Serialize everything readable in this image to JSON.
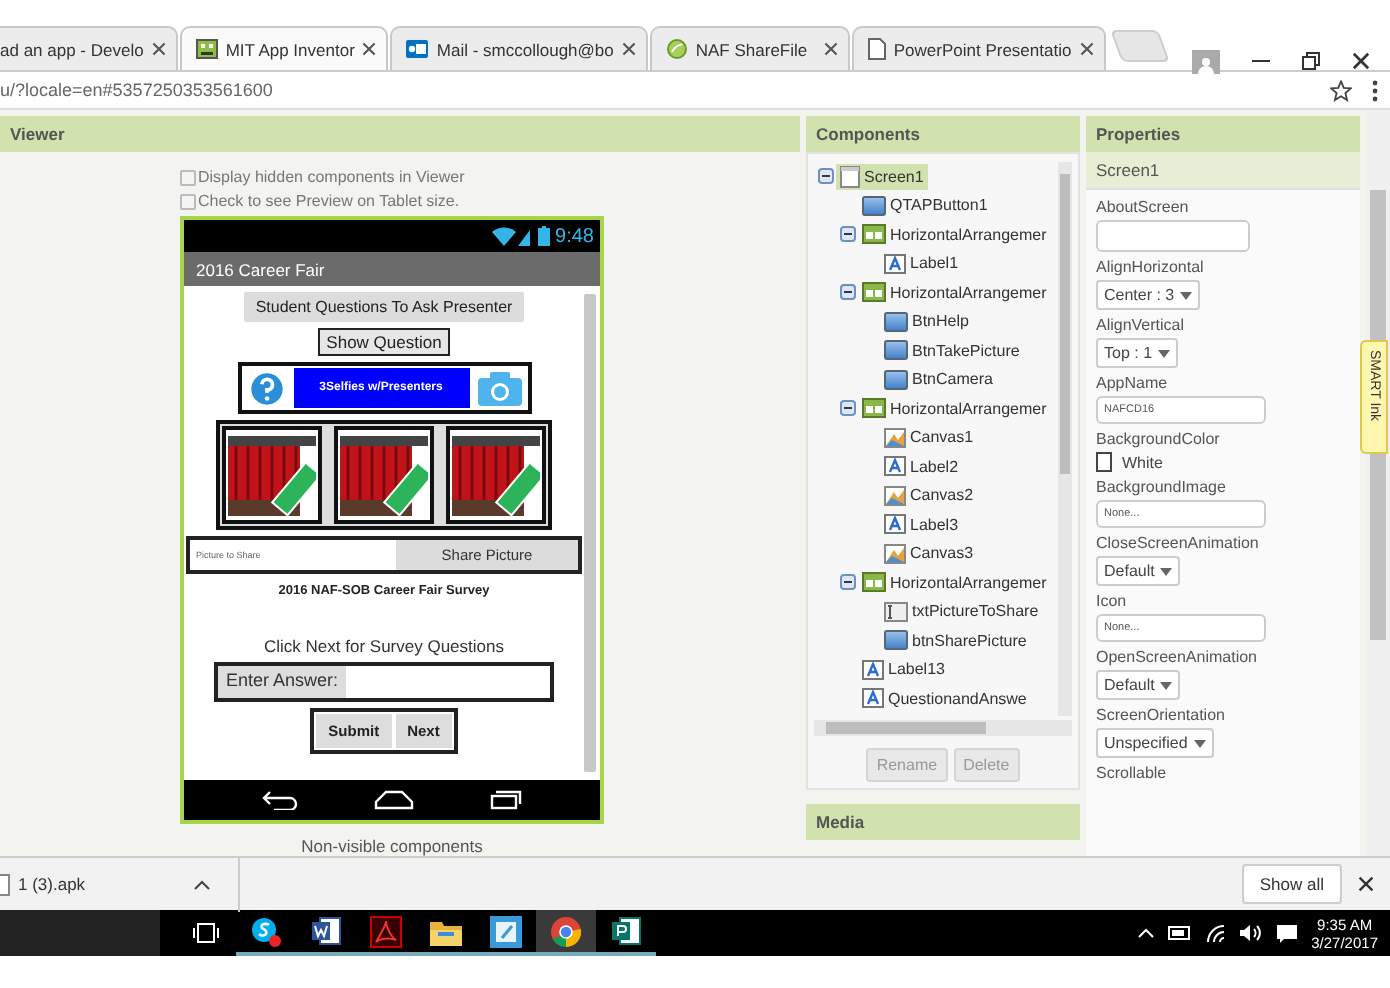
{
  "browser": {
    "tabs": [
      {
        "title": "ad an app - Develo",
        "kind": "none",
        "selected": false
      },
      {
        "title": "MIT App Inventor",
        "kind": "robot",
        "selected": true
      },
      {
        "title": "Mail - smccollough@bo",
        "kind": "mail",
        "selected": false
      },
      {
        "title": "NAF ShareFile",
        "kind": "leaf",
        "selected": false
      },
      {
        "title": "PowerPoint Presentatio",
        "kind": "page",
        "selected": false
      }
    ],
    "address": "u/?locale=en#5357250353561600"
  },
  "viewer": {
    "title": "Viewer",
    "options": [
      {
        "label": "Display hidden components in Viewer",
        "checked": false
      },
      {
        "label": "Check to see Preview on Tablet size.",
        "checked": false
      }
    ],
    "phone": {
      "time": "9:48",
      "title": "2016 Career Fair",
      "items": [
        {
          "kind": "button",
          "text": "Student Questions To Ask Presenter"
        },
        {
          "kind": "outlined_button",
          "text": "Show Question"
        },
        {
          "kind": "icon_row",
          "text": "3Selfies w/Presenters"
        },
        {
          "kind": "canvas_row",
          "canvases": [
            {
              "kind": "picture"
            },
            {
              "kind": "picture"
            },
            {
              "kind": "picture"
            }
          ]
        },
        {
          "kind": "share_row",
          "placeholder": "Picture to Share",
          "button": "Share Picture"
        },
        {
          "kind": "caption",
          "text": "2016 NAF-SOB Career Fair Survey"
        },
        {
          "kind": "label",
          "text": "Click Next for Survey Questions"
        },
        {
          "kind": "answer_row",
          "label": "Enter Answer:"
        },
        {
          "kind": "button_row",
          "buttons": [
            "Submit",
            "Next"
          ]
        }
      ]
    },
    "non_visible": "Non-visible components"
  },
  "components": {
    "title": "Components",
    "tree": [
      {
        "name": "Screen1",
        "kind": "screen",
        "selected": true,
        "expanded": true,
        "children": [
          {
            "name": "QTAPButton1",
            "kind": "button",
            "selected": false
          },
          {
            "name": "HorizontalArrangemer",
            "kind": "arrangement",
            "selected": false,
            "expanded": true,
            "children": [
              {
                "name": "Label1",
                "kind": "label",
                "selected": false
              }
            ]
          },
          {
            "name": "HorizontalArrangemer",
            "kind": "arrangement",
            "selected": false,
            "expanded": true,
            "children": [
              {
                "name": "BtnHelp",
                "kind": "button",
                "selected": false
              },
              {
                "name": "BtnTakePicture",
                "kind": "button",
                "selected": false
              },
              {
                "name": "BtnCamera",
                "kind": "button",
                "selected": false
              }
            ]
          },
          {
            "name": "HorizontalArrangemer",
            "kind": "arrangement",
            "selected": false,
            "expanded": true,
            "children": [
              {
                "name": "Canvas1",
                "kind": "canvas",
                "selected": false
              },
              {
                "name": "Label2",
                "kind": "label",
                "selected": false
              },
              {
                "name": "Canvas2",
                "kind": "canvas",
                "selected": false
              },
              {
                "name": "Label3",
                "kind": "label",
                "selected": false
              },
              {
                "name": "Canvas3",
                "kind": "canvas",
                "selected": false
              }
            ]
          },
          {
            "name": "HorizontalArrangemer",
            "kind": "arrangement",
            "selected": false,
            "expanded": true,
            "children": [
              {
                "name": "txtPictureToShare",
                "kind": "textbox",
                "selected": false
              },
              {
                "name": "btnSharePicture",
                "kind": "button",
                "selected": false
              }
            ]
          },
          {
            "name": "Label13",
            "kind": "label",
            "selected": false
          },
          {
            "name": "QuestionandAnswe",
            "kind": "label",
            "selected": false
          }
        ]
      }
    ],
    "buttons": [
      {
        "label": "Rename",
        "disabled": true
      },
      {
        "label": "Delete",
        "disabled": true
      }
    ]
  },
  "media": {
    "title": "Media"
  },
  "properties": {
    "title": "Properties",
    "component": "Screen1",
    "items": [
      {
        "label": "AboutScreen",
        "kind": "textarea"
      },
      {
        "label": "AlignHorizontal",
        "kind": "dropdown",
        "value": "Center : 3"
      },
      {
        "label": "AlignVertical",
        "kind": "dropdown",
        "value": "Top : 1"
      },
      {
        "label": "AppName",
        "kind": "text",
        "value": "NAFCD16"
      },
      {
        "label": "BackgroundColor",
        "kind": "color",
        "value": "White",
        "color": "#ffffff"
      },
      {
        "label": "BackgroundImage",
        "kind": "text",
        "value": "None..."
      },
      {
        "label": "CloseScreenAnimation",
        "kind": "dropdown",
        "value": "Default"
      },
      {
        "label": "Icon",
        "kind": "text",
        "value": "None..."
      },
      {
        "label": "OpenScreenAnimation",
        "kind": "dropdown",
        "value": "Default"
      },
      {
        "label": "ScreenOrientation",
        "kind": "dropdown",
        "value": "Unspecified"
      },
      {
        "label": "Scrollable"
      }
    ]
  },
  "smart_ink": {
    "label": "SMART Ink"
  },
  "downloads": {
    "file": "1 (3).apk",
    "show_all": "Show all"
  },
  "taskbar": {
    "apps": [
      {
        "kind": "task-view",
        "selected": false
      },
      {
        "kind": "chat",
        "selected": false
      },
      {
        "kind": "word",
        "selected": false
      },
      {
        "kind": "pdf",
        "selected": false
      },
      {
        "kind": "folder",
        "selected": false
      },
      {
        "kind": "notes",
        "selected": false
      },
      {
        "kind": "browser",
        "selected": true
      },
      {
        "kind": "publisher",
        "selected": false
      }
    ],
    "time": "9:35 AM",
    "date": "3/27/2017"
  }
}
